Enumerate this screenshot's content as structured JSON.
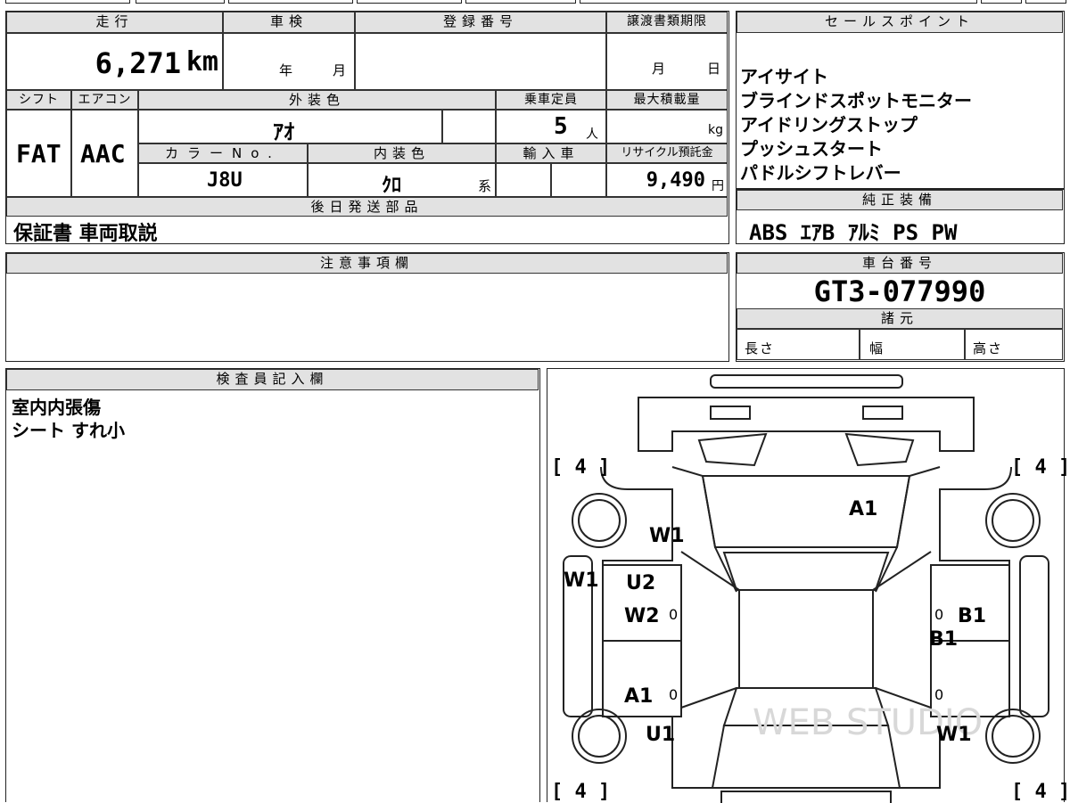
{
  "top": {
    "mileage_label": "走行",
    "mileage_value": "6,271",
    "mileage_unit": "km",
    "inspection_label": "車検",
    "inspection_year_unit": "年",
    "inspection_month_unit": "月",
    "registration_label": "登録番号",
    "transfer_deadline_label": "譲渡書類期限",
    "transfer_month_unit": "月",
    "transfer_day_unit": "日",
    "shift_label": "シフト",
    "shift_value": "FAT",
    "aircon_label": "エアコン",
    "aircon_value": "AAC",
    "exterior_color_label": "外装色",
    "exterior_color_value": "ｱｵ",
    "capacity_label": "乗車定員",
    "capacity_value": "5",
    "capacity_unit": "人",
    "max_load_label": "最大積載量",
    "max_load_unit": "kg",
    "color_no_label": "カラーNo.",
    "color_no_value": "J8U",
    "interior_color_label": "内装色",
    "interior_color_value": "ｸﾛ",
    "interior_color_suffix": "系",
    "import_label": "輸入車",
    "recycle_label": "リサイクル預託金",
    "recycle_value": "9,490",
    "recycle_unit": "円",
    "later_parts_label": "後日発送部品",
    "later_parts_value": "保証書 車両取説"
  },
  "sales_points": {
    "label": "セールスポイント",
    "items": [
      "アイサイト",
      "ブラインドスポットモニター",
      "アイドリングストップ",
      "プッシュスタート",
      "パドルシフトレバー"
    ]
  },
  "equipment": {
    "label": "純正装備",
    "value": "ABS ｴｱB ｱﾙﾐ PS PW"
  },
  "notes": {
    "label": "注意事項欄"
  },
  "chassis": {
    "label": "車台番号",
    "value": "GT3-077990"
  },
  "specs": {
    "label": "諸元",
    "length_label": "長さ",
    "width_label": "幅",
    "height_label": "高さ"
  },
  "inspector": {
    "label": "検査員記入欄",
    "lines": [
      "室内内張傷",
      "シート すれ小"
    ]
  },
  "diagram": {
    "tire_fl": "[ 4 ]",
    "tire_fr": "[ 4 ]",
    "tire_rl": "[ 4 ]",
    "tire_rr": "[ 4 ]",
    "marks": [
      "A1",
      "W1",
      "W1",
      "U2",
      "W2",
      "0",
      "A1",
      "0",
      "U1",
      "0",
      "B1",
      "B1",
      "0",
      "W1"
    ],
    "watermark": "WEB STUDIO"
  }
}
